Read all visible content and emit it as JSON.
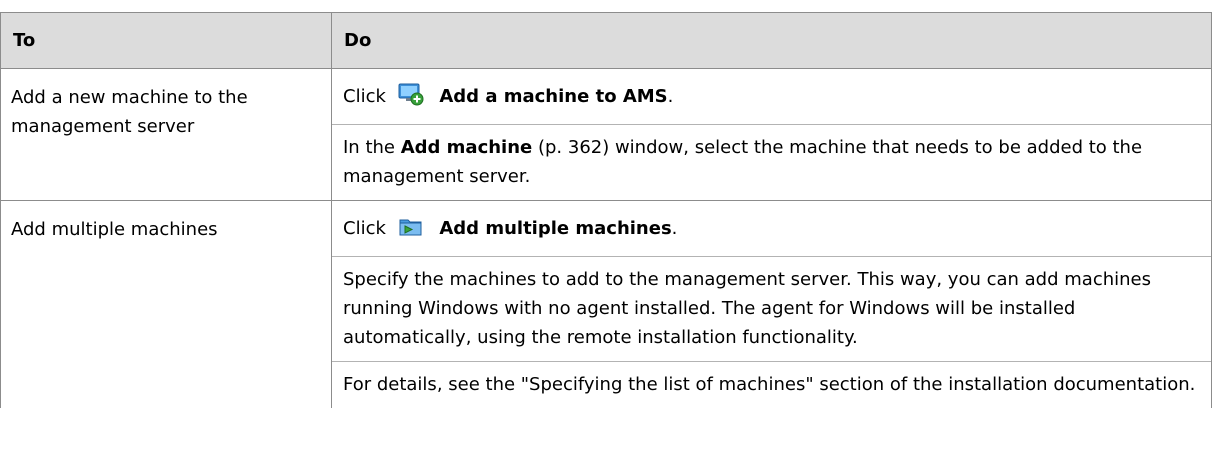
{
  "table": {
    "headers": {
      "col_to": "To",
      "col_do": "Do"
    },
    "rows": [
      {
        "to": "Add a new machine to the management server",
        "click_prefix": "Click",
        "action_label": "Add a machine to AMS",
        "action_icon": "add-machine-icon",
        "para2_pre": "In the ",
        "para2_bold": "Add machine",
        "para2_post": " (p. 362) window, select the machine that needs to be added to the management server."
      },
      {
        "to": "Add multiple machines",
        "click_prefix": "Click",
        "action_label": "Add multiple machines",
        "action_icon": "add-multiple-machines-icon",
        "para2": "Specify the machines to add to the management server. This way, you can add machines running Windows with no agent installed. The agent for Windows will be installed automatically, using the remote installation functionality.",
        "para3": "For details, see the \"Specifying the list of machines\" section of the installation documentation."
      }
    ]
  }
}
